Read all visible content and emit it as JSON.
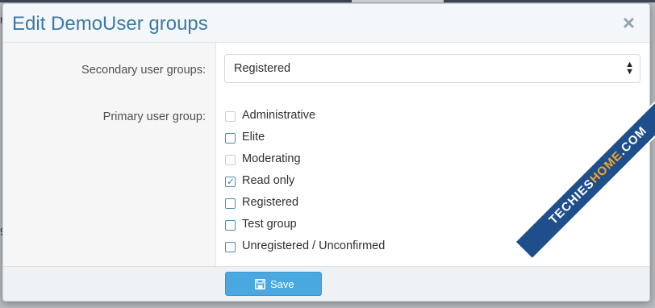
{
  "backdrop": {
    "edge_glyph_1": "r",
    "edge_glyph_2": "9"
  },
  "modal": {
    "title": "Edit DemoUser groups",
    "close_symbol": "×",
    "secondary_label": "Secondary user groups:",
    "secondary_select": {
      "selected": "Registered"
    },
    "primary_label": "Primary user group:",
    "groups": [
      {
        "label": "Administrative",
        "checked": false,
        "disabled": true
      },
      {
        "label": "Elite",
        "checked": false,
        "disabled": false
      },
      {
        "label": "Moderating",
        "checked": false,
        "disabled": true
      },
      {
        "label": "Read only",
        "checked": true,
        "disabled": false
      },
      {
        "label": "Registered",
        "checked": false,
        "disabled": false
      },
      {
        "label": "Test group",
        "checked": false,
        "disabled": false
      },
      {
        "label": "Unregistered / Unconfirmed",
        "checked": false,
        "disabled": false
      }
    ],
    "save_label": "Save"
  },
  "watermark": {
    "text_part1": "TECHIES",
    "text_part2": "HOME",
    "text_part3": ".COM"
  },
  "colors": {
    "title": "#3b7aa8",
    "save_button": "#4aa8e0",
    "checkbox": "#4b8fa8"
  }
}
